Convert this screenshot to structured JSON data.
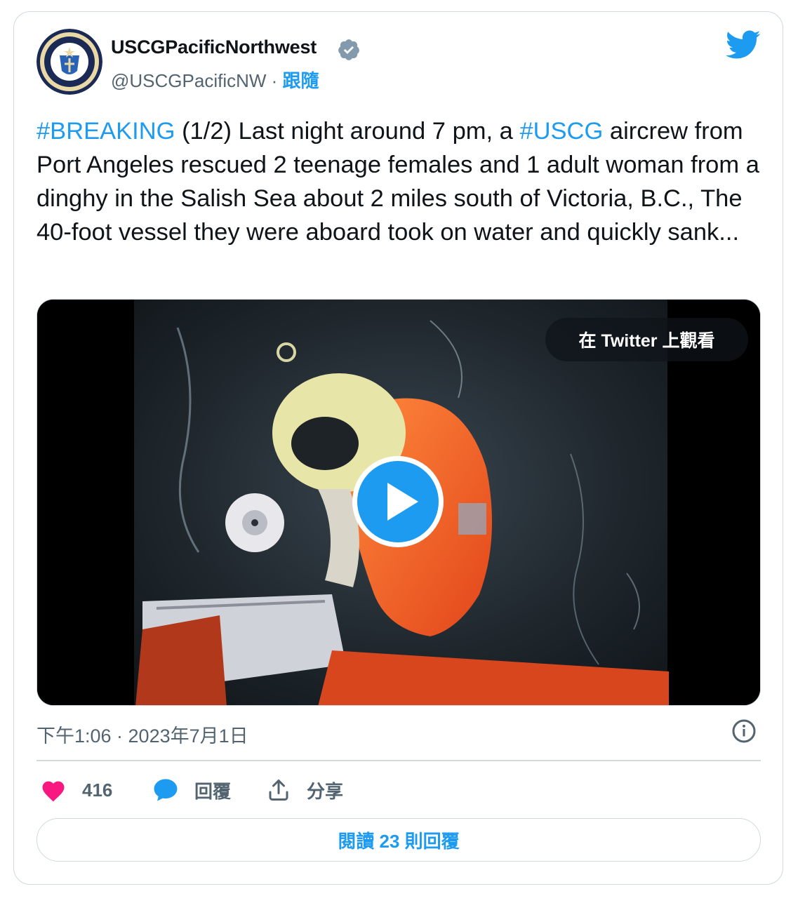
{
  "author": {
    "display_name": "USCGPacificNorthwest",
    "handle": "@USCGPacificNW",
    "separator": "·",
    "follow_label": "跟隨",
    "avatar_icon": "uscg-thirteenth-district-seal"
  },
  "tweet": {
    "segments": [
      {
        "text": "#BREAKING",
        "type": "hashtag"
      },
      {
        "text": " (1/2) Last night around 7 pm, a ",
        "type": "text"
      },
      {
        "text": "#USCG",
        "type": "hashtag"
      },
      {
        "text": " aircrew from Port Angeles rescued 2 teenage females and 1 adult woman from a dinghy in the Salish Sea about 2 miles south of Victoria, B.C., The 40-foot vessel they were aboard took on water and quickly sank...",
        "type": "text"
      }
    ]
  },
  "media": {
    "watch_label": "在 Twitter 上觀看",
    "play_icon": "play-icon"
  },
  "meta": {
    "timestamp": "下午1:06 · 2023年7月1日"
  },
  "actions": {
    "like_count": "416",
    "reply_label": "回覆",
    "share_label": "分享"
  },
  "read_replies_label": "閱讀 23 則回覆",
  "colors": {
    "accent": "#1d9bf0",
    "like": "#f91880",
    "text": "#0f1419",
    "muted": "#536471",
    "border": "#cfd9de"
  }
}
